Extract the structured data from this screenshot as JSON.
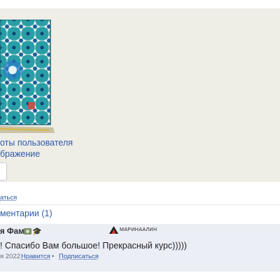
{
  "gallery": {
    "caption_user_photos": "оты пользователя",
    "caption_image": "бражение"
  },
  "actions": {
    "subscribe_top": "аться"
  },
  "comments": {
    "header": "ментарии (1)",
    "items": [
      {
        "author": "я Фам",
        "brand_logo_text": "МАРИНААЛИН",
        "text": "! Спасибо Вам большое! Прекрасный курс)))))",
        "date": "я 2022",
        "like_label": "Нравится",
        "subscribe_label": "Подписаться"
      }
    ]
  },
  "colors": {
    "link": "#2f5aa8",
    "gallery_bg": "#eeede6",
    "comment_bg": "#eceef5",
    "tile_teal": "#2aa1a8"
  },
  "icons": {
    "certificate": "certificate-icon",
    "graduation": "graduation-cap-icon",
    "logo": "brand-logo-icon"
  }
}
